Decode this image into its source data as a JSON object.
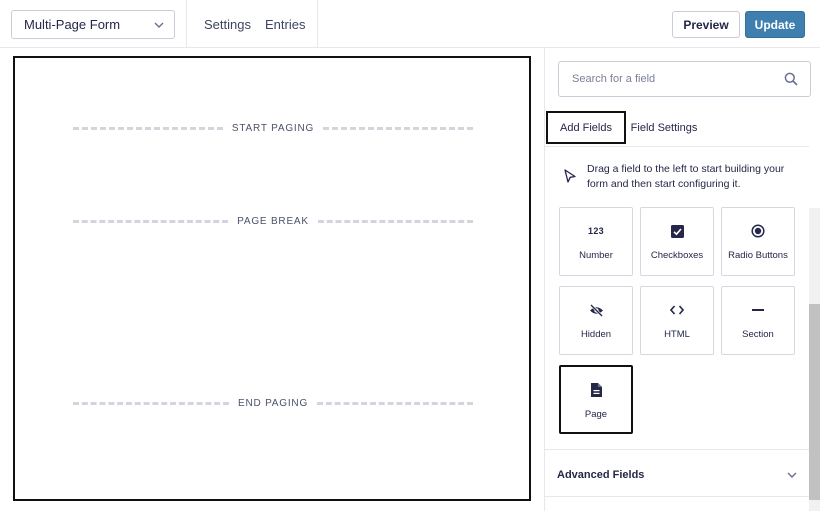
{
  "header": {
    "form_name": "Multi-Page Form",
    "nav": [
      "Settings",
      "Entries"
    ],
    "preview_label": "Preview",
    "update_label": "Update"
  },
  "canvas": {
    "start_paging": "START PAGING",
    "page_break": "PAGE BREAK",
    "end_paging": "END PAGING"
  },
  "sidebar": {
    "search_placeholder": "Search for a field",
    "tabs": [
      "Add Fields",
      "Field Settings"
    ],
    "hint": "Drag a field to the left to start building your form and then start configuring it.",
    "fields": [
      {
        "label": "Number",
        "icon": "number-icon"
      },
      {
        "label": "Checkboxes",
        "icon": "checkbox-icon"
      },
      {
        "label": "Radio Buttons",
        "icon": "radio-icon"
      },
      {
        "label": "Hidden",
        "icon": "eye-off-icon"
      },
      {
        "label": "HTML",
        "icon": "code-icon"
      },
      {
        "label": "Section",
        "icon": "minus-icon"
      },
      {
        "label": "Page",
        "icon": "document-icon"
      }
    ],
    "number_glyph": "123",
    "advanced_label": "Advanced Fields"
  },
  "colors": {
    "accent": "#3e7fb0",
    "text": "#242748",
    "border": "#c9cdd8"
  }
}
